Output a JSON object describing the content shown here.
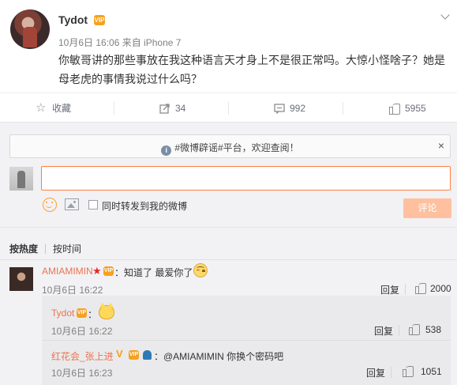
{
  "post": {
    "author": "Tydot",
    "vip_badge": "VIP",
    "meta": "10月6日 16:06 来自 iPhone 7",
    "text": "你敏哥讲的那些事放在我这种语言天才身上不是很正常吗。大惊小怪啥子？她是母老虎的事情我说过什么吗？"
  },
  "actions": {
    "favorite_label": "收藏",
    "forward_count": "34",
    "comment_count": "992",
    "like_count": "5955"
  },
  "notice": {
    "icon": "i",
    "text": "#微博辟谣#平台，欢迎查阅！",
    "close": "×"
  },
  "composer": {
    "input_value": "",
    "forward_checkbox_label": "同时转发到我的微博",
    "submit_label": "评论"
  },
  "sort": {
    "hot_label": "按热度",
    "time_label": "按时间"
  },
  "comments": [
    {
      "author": "AMIAMIMIN",
      "text": "：知道了 最爱你了",
      "time": "10月6日 16:22",
      "reply_label": "回复",
      "likes": "2000"
    }
  ],
  "replies": [
    {
      "author": "Tydot",
      "text": "：",
      "time": "10月6日 16:22",
      "reply_label": "回复",
      "likes": "538"
    },
    {
      "author": "红花会_张上进",
      "badge_v": "V",
      "text": "：@AMIAMIMIN 你换个密码吧",
      "time": "10月6日 16:23",
      "reply_label": "回复",
      "likes": "1051"
    }
  ],
  "colors": {
    "accent_orange": "#ff8140",
    "username_orange": "#eb7350",
    "submit_disabled": "#ffc09f",
    "grey_bg": "#f2f2f5"
  }
}
